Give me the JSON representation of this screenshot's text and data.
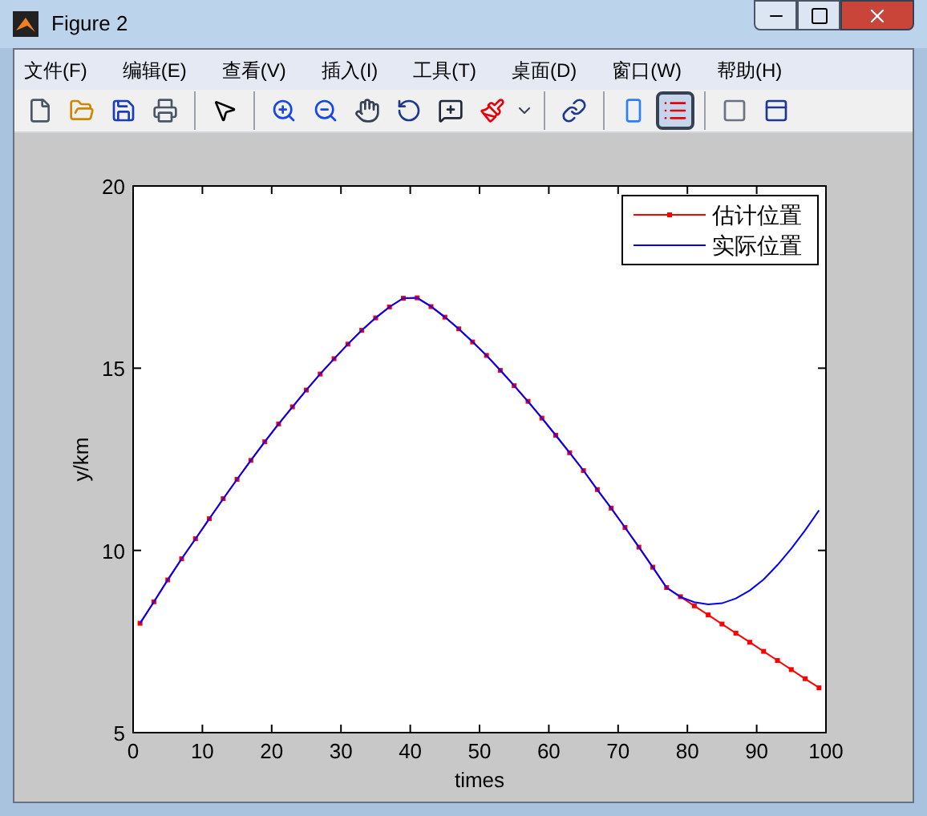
{
  "window": {
    "title": "Figure 2"
  },
  "menu": [
    "文件(F)",
    "编辑(E)",
    "查看(V)",
    "插入(I)",
    "工具(T)",
    "桌面(D)",
    "窗口(W)",
    "帮助(H)"
  ],
  "toolbar": [
    {
      "kind": "new",
      "pressed": false
    },
    {
      "kind": "open",
      "pressed": false
    },
    {
      "kind": "save",
      "pressed": false
    },
    {
      "kind": "print",
      "pressed": false
    },
    {
      "kind": "separator"
    },
    {
      "kind": "pointer",
      "pressed": false
    },
    {
      "kind": "separator"
    },
    {
      "kind": "zoom-in",
      "pressed": false
    },
    {
      "kind": "zoom-out",
      "pressed": false
    },
    {
      "kind": "pan",
      "pressed": false
    },
    {
      "kind": "rotate",
      "pressed": false
    },
    {
      "kind": "data-cursor",
      "pressed": false
    },
    {
      "kind": "brush",
      "pressed": false
    },
    {
      "kind": "caret",
      "pressed": false
    },
    {
      "kind": "separator"
    },
    {
      "kind": "link",
      "pressed": false
    },
    {
      "kind": "separator"
    },
    {
      "kind": "colorbar",
      "pressed": false
    },
    {
      "kind": "legend",
      "pressed": true
    },
    {
      "kind": "separator"
    },
    {
      "kind": "hide",
      "pressed": false
    },
    {
      "kind": "dock",
      "pressed": false
    }
  ],
  "chart_data": {
    "type": "line",
    "legend": true,
    "xlabel": "times",
    "ylabel": "y/km",
    "xlim": [
      0,
      100
    ],
    "ylim": [
      5,
      20
    ],
    "xticks": [
      0,
      10,
      20,
      30,
      40,
      50,
      60,
      70,
      80,
      90,
      100
    ],
    "yticks": [
      5,
      10,
      15,
      20
    ],
    "x": [
      1,
      3,
      5,
      7,
      9,
      11,
      13,
      15,
      17,
      19,
      21,
      23,
      25,
      27,
      29,
      31,
      33,
      35,
      37,
      39,
      41,
      43,
      45,
      47,
      49,
      51,
      53,
      55,
      57,
      59,
      61,
      63,
      65,
      67,
      69,
      71,
      73,
      75,
      77,
      79,
      81,
      83,
      85,
      87,
      89,
      91,
      93,
      95,
      97,
      99
    ],
    "series": [
      {
        "name": "估计位置",
        "color": "#ff0000",
        "marker": "square",
        "values": [
          8.0,
          8.59,
          9.19,
          9.77,
          10.32,
          10.87,
          11.42,
          11.95,
          12.47,
          12.98,
          13.47,
          13.94,
          14.4,
          14.84,
          15.26,
          15.66,
          16.04,
          16.38,
          16.68,
          16.92,
          16.93,
          16.69,
          16.4,
          16.08,
          15.72,
          15.35,
          14.94,
          14.52,
          14.09,
          13.63,
          13.16,
          12.68,
          12.19,
          11.67,
          11.16,
          10.63,
          10.09,
          9.54,
          8.98,
          8.73,
          8.48,
          8.23,
          7.98,
          7.73,
          7.48,
          7.23,
          6.98,
          6.73,
          6.48,
          6.23
        ]
      },
      {
        "name": "实际位置",
        "color": "#0000ff",
        "values": [
          8.0,
          8.59,
          9.19,
          9.77,
          10.32,
          10.87,
          11.42,
          11.95,
          12.47,
          12.98,
          13.47,
          13.94,
          14.4,
          14.84,
          15.26,
          15.66,
          16.04,
          16.38,
          16.68,
          16.92,
          16.93,
          16.69,
          16.4,
          16.08,
          15.72,
          15.35,
          14.94,
          14.52,
          14.09,
          13.63,
          13.16,
          12.68,
          12.19,
          11.67,
          11.16,
          10.63,
          10.09,
          9.54,
          8.98,
          8.72,
          8.58,
          8.52,
          8.55,
          8.68,
          8.9,
          9.2,
          9.6,
          10.05,
          10.55,
          11.1
        ]
      }
    ]
  }
}
